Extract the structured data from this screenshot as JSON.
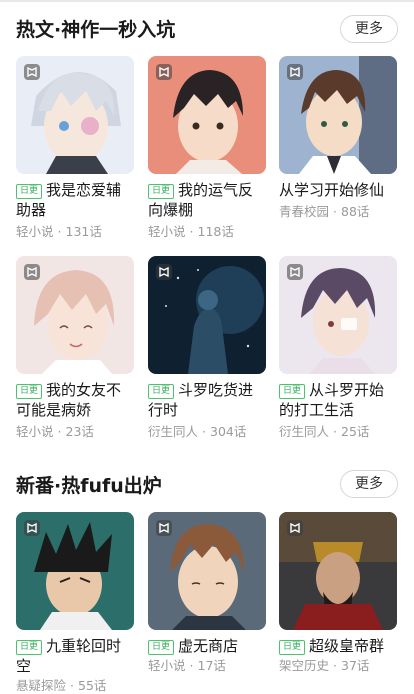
{
  "sections": [
    {
      "title": "热文·神作一秒入坑",
      "more_label": "更多",
      "items": [
        {
          "tag": "日更",
          "title": "我是恋爱辅助器",
          "category": "轻小说",
          "chapters": "131话"
        },
        {
          "tag": "日更",
          "title": "我的运气反向爆棚",
          "category": "轻小说",
          "chapters": "118话"
        },
        {
          "tag": "",
          "title": "从学习开始修仙",
          "category": "青春校园",
          "chapters": "88话"
        },
        {
          "tag": "日更",
          "title": "我的女友不可能是病娇",
          "category": "轻小说",
          "chapters": "23话"
        },
        {
          "tag": "日更",
          "title": "斗罗吃货进行时",
          "category": "衍生同人",
          "chapters": "304话"
        },
        {
          "tag": "日更",
          "title": "从斗罗开始的打工生活",
          "category": "衍生同人",
          "chapters": "25话"
        }
      ]
    },
    {
      "title": "新番·热fufu出炉",
      "more_label": "更多",
      "items": [
        {
          "tag": "日更",
          "title": "九重轮回时空",
          "category": "悬疑探险",
          "chapters": "55话"
        },
        {
          "tag": "日更",
          "title": "虚无商店",
          "category": "轻小说",
          "chapters": "17话"
        },
        {
          "tag": "日更",
          "title": "超级皇帝群",
          "category": "架空历史",
          "chapters": "37话"
        }
      ]
    }
  ],
  "colors": {
    "tag_green": "#3ab060",
    "meta_gray": "#9a9a9a",
    "title": "#1a1a1a"
  },
  "icons": {
    "cover_badge": "book-badge-icon"
  }
}
